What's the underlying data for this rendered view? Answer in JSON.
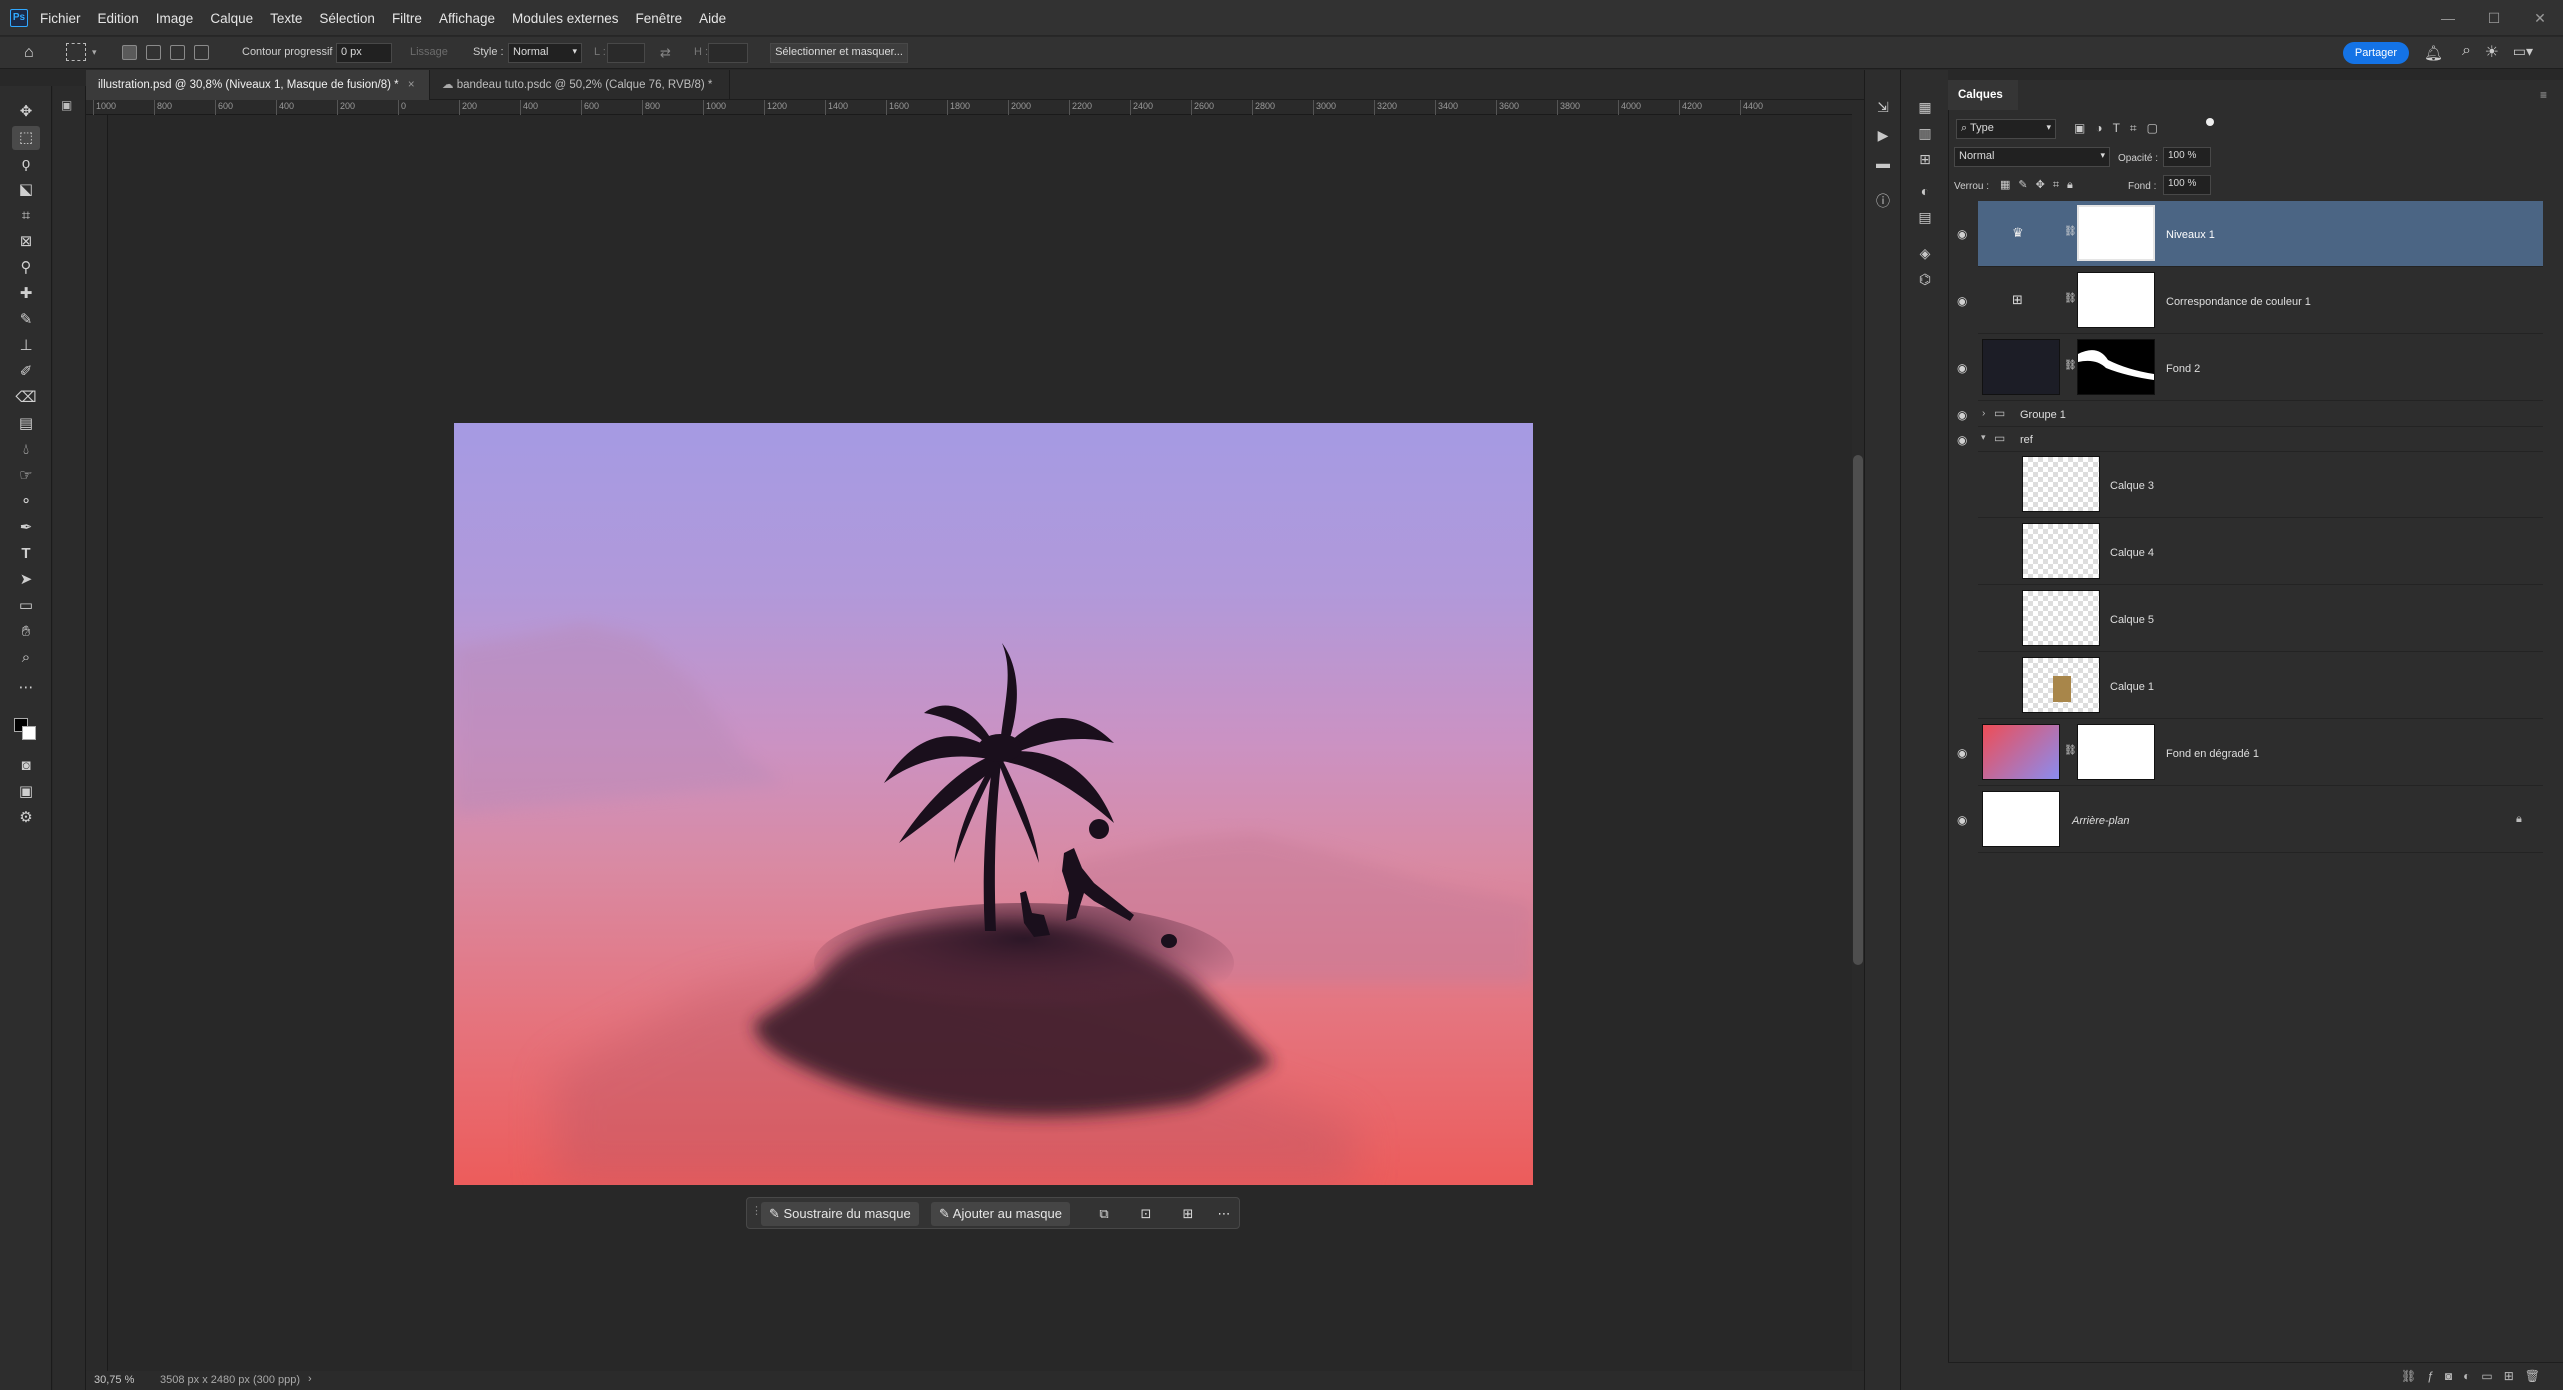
{
  "app": {
    "logo": "Ps"
  },
  "menu": [
    "Fichier",
    "Edition",
    "Image",
    "Calque",
    "Texte",
    "Sélection",
    "Filtre",
    "Affichage",
    "Modules externes",
    "Fenêtre",
    "Aide"
  ],
  "options": {
    "feather_label": "Contour progressif :",
    "feather_value": "0 px",
    "antialias_label": "Lissage",
    "style_label": "Style :",
    "style_value": "Normal",
    "width_label": "L :",
    "height_label": "H :",
    "select_mask_btn": "Sélectionner et masquer...",
    "share": "Partager"
  },
  "tabs": [
    {
      "label": "illustration.psd @ 30,8% (Niveaux 1, Masque de fusion/8) *",
      "active": true
    },
    {
      "label": "bandeau tuto.psdc @ 50,2% (Calque 76, RVB/8) *",
      "active": false
    }
  ],
  "ruler_top": [
    "1000",
    "800",
    "600",
    "400",
    "200",
    "0",
    "200",
    "400",
    "600",
    "800",
    "1000",
    "1200",
    "1400",
    "1600",
    "1800",
    "2000",
    "2200",
    "2400",
    "2600",
    "2800",
    "3000",
    "3200",
    "3400",
    "3600",
    "3800",
    "4000",
    "4200",
    "4400"
  ],
  "context_bar": {
    "subtract": "Soustraire du masque",
    "add": "Ajouter au masque",
    "more": "⋯"
  },
  "status": {
    "zoom": "30,75 %",
    "doc_info": "3508 px x 2480 px (300 ppp)"
  },
  "layers_panel": {
    "title": "Calques",
    "filter_value": "Type",
    "blend_mode": "Normal",
    "opacity_label": "Opacité :",
    "opacity_value": "100 %",
    "lock_label": "Verrou :",
    "fill_label": "Fond :",
    "fill_value": "100 %",
    "layers": [
      {
        "name": "Niveaux 1"
      },
      {
        "name": "Correspondance de couleur 1"
      },
      {
        "name": "Fond 2"
      },
      {
        "name": "Groupe 1"
      },
      {
        "name": "ref"
      },
      {
        "name": "Calque 3"
      },
      {
        "name": "Calque 4"
      },
      {
        "name": "Calque 5"
      },
      {
        "name": "Calque 1"
      },
      {
        "name": "Fond en dégradé 1"
      },
      {
        "name": "Arrière-plan"
      }
    ]
  },
  "colors": {
    "accent": "#1473e6",
    "selected_layer": "#4b6584",
    "sky_top": "#a59ae3",
    "sky_bottom": "#ec5c5b"
  }
}
